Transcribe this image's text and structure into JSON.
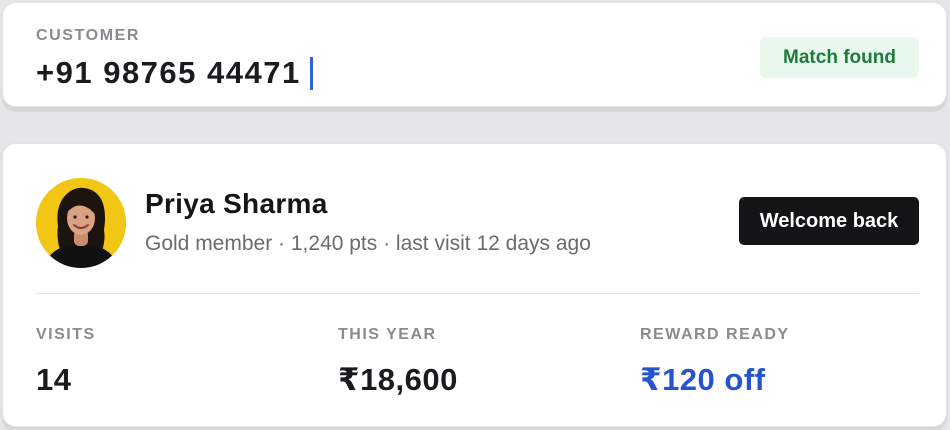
{
  "customer": {
    "label": "CUSTOMER",
    "phone_value": "+91 98765 44471",
    "match_status": "Match found"
  },
  "profile": {
    "name": "Priya Sharma",
    "meta": "Gold member · 1,240 pts · last visit 12 days ago",
    "welcome_button": "Welcome back"
  },
  "stats": {
    "visits": {
      "label": "VISITS",
      "value": "14"
    },
    "this_year": {
      "label": "THIS YEAR",
      "value": "₹18,600"
    },
    "reward": {
      "label": "REWARD READY",
      "value": "₹120 off"
    }
  },
  "colors": {
    "accent_blue": "#2553d1",
    "match_green": "#1f7a3d",
    "match_bg": "#e9f8ee",
    "avatar_bg": "#f2c615"
  }
}
